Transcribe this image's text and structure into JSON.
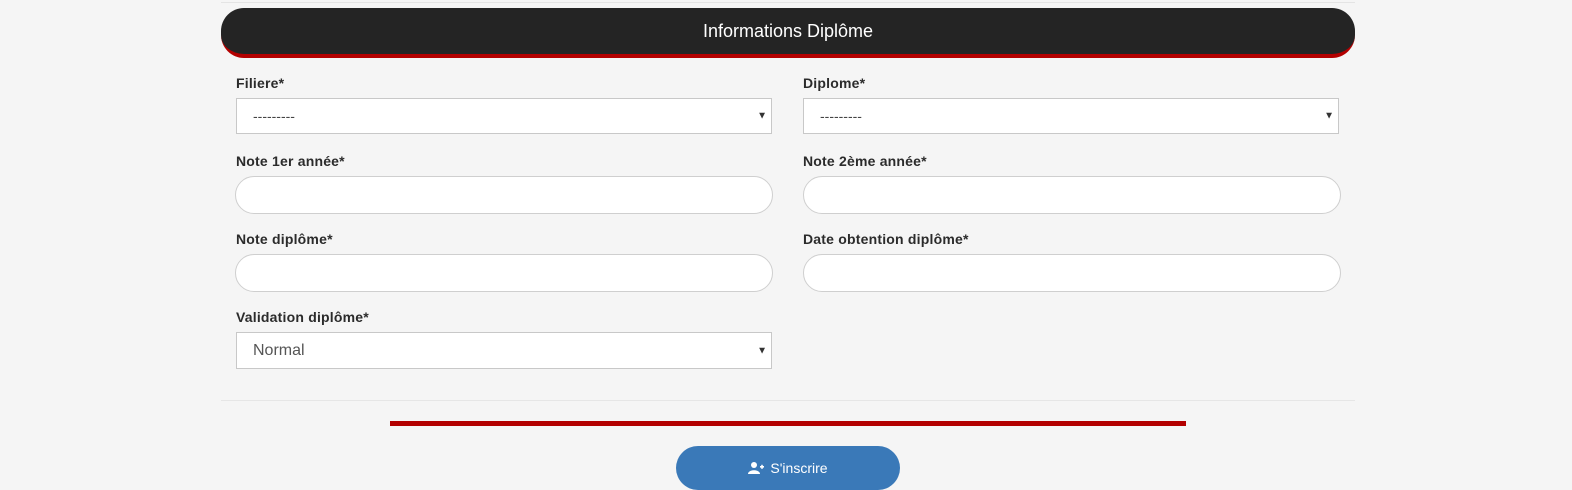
{
  "section": {
    "title": "Informations Diplôme"
  },
  "fields": {
    "filiere": {
      "label": "Filiere*",
      "value": "---------"
    },
    "diplome": {
      "label": "Diplome*",
      "value": "---------"
    },
    "note_1er": {
      "label": "Note 1er année*",
      "value": ""
    },
    "note_2eme": {
      "label": "Note 2ème année*",
      "value": ""
    },
    "note_diplome": {
      "label": "Note diplôme*",
      "value": ""
    },
    "date_obtention": {
      "label": "Date obtention diplôme*",
      "value": ""
    },
    "validation": {
      "label": "Validation diplôme*",
      "value": "Normal"
    }
  },
  "actions": {
    "submit_label": "S'inscrire",
    "submit_icon": "user-plus-icon"
  },
  "colors": {
    "header_bg": "#242424",
    "accent_red": "#b30000",
    "button_blue": "#3a79b8",
    "page_bg": "#f5f5f5"
  }
}
